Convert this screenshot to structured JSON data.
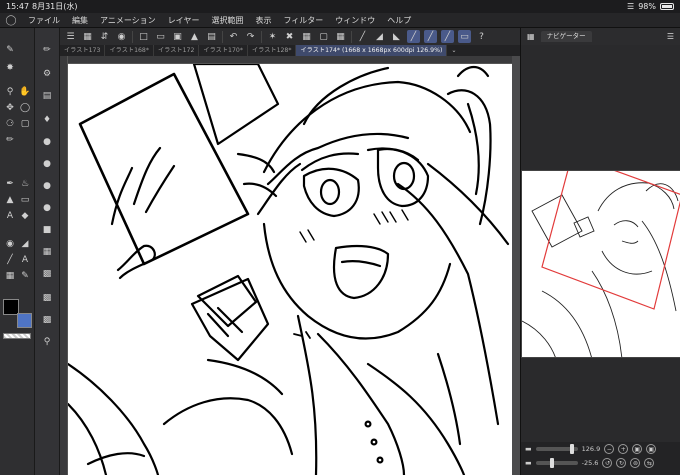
{
  "status": {
    "time": "15:47",
    "date": "8月31日(水)",
    "battery": "98%",
    "battery_level": 0.98
  },
  "menu": {
    "items": [
      "ファイル",
      "編集",
      "アニメーション",
      "レイヤー",
      "選択範囲",
      "表示",
      "フィルター",
      "ウィンドウ",
      "ヘルプ"
    ]
  },
  "tabs": [
    {
      "label": "イラスト173",
      "active": false
    },
    {
      "label": "イラスト168*",
      "active": false
    },
    {
      "label": "イラスト172",
      "active": false
    },
    {
      "label": "イラスト170*",
      "active": false
    },
    {
      "label": "イラスト128*",
      "active": false
    },
    {
      "label": "イラスト174* (1668 x 1668px 600dpi 126.9%)",
      "active": true
    }
  ],
  "panel": {
    "navigator_tab": "ナビゲーター"
  },
  "navigator": {
    "zoom": "126.9",
    "rotation": "-25.6"
  },
  "colors": {
    "main": "#000000",
    "sub": "#4f74c4",
    "active_tab": "#3f4a6c",
    "nav_frame": "#e23b3b"
  }
}
